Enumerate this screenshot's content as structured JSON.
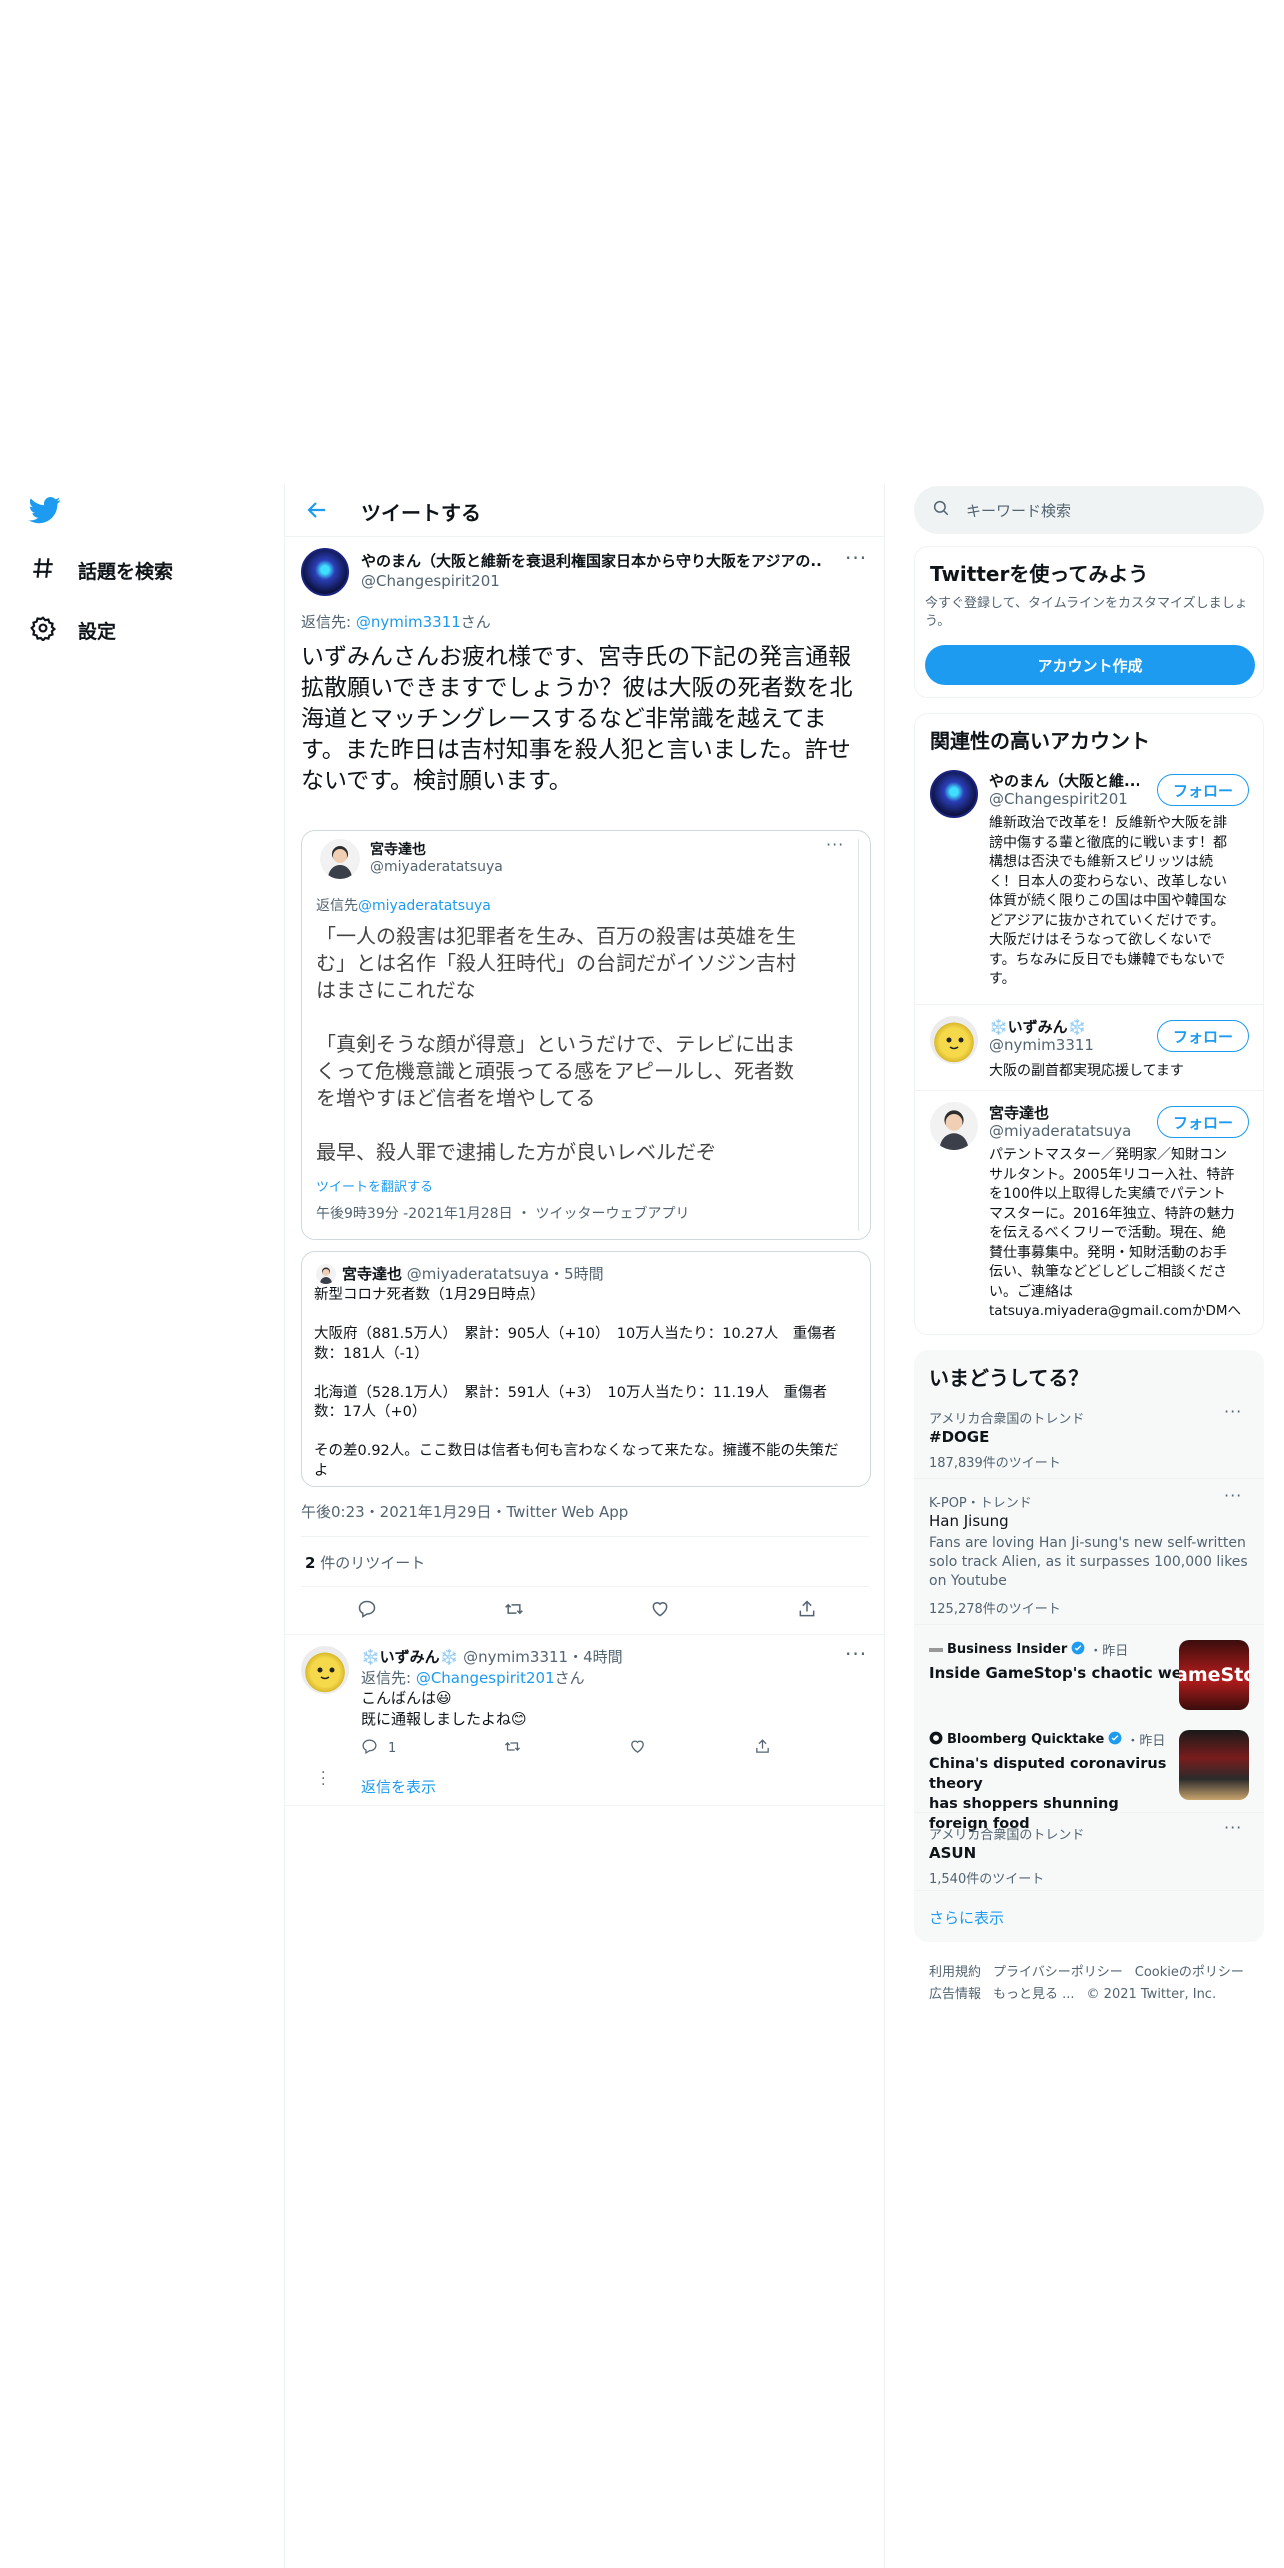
{
  "nav": {
    "explore_label": "話題を検索",
    "settings_label": "設定"
  },
  "header": {
    "title": "ツイートする"
  },
  "main_tweet": {
    "display_name": "やのまん（大阪と維新を衰退利権国家日本から守り大阪をアジアの...",
    "handle": "@Changespirit201",
    "reply_prefix": "返信先: ",
    "reply_to": "@nymim3311",
    "reply_suffix": "さん",
    "text_lines": [
      "いずみんさんお疲れ様です、宮寺氏の下記の発言通報",
      "拡散願いできますでしょうか？彼は大阪の死者数を北",
      "海道とマッチングレースするなど非常識を越えてま",
      "す。また昨日は吉村知事を殺人犯と言いました。許せ",
      "ないです。検討願います。"
    ],
    "timestamp": "午後0:23・2021年1月29日・Twitter Web App",
    "retweet_count": "2",
    "retweet_label": " 件のリツイート"
  },
  "embedded_tweet": {
    "display_name": "宮寺達也",
    "handle": "@miyaderatatsuya",
    "reply_prefix": "返信先",
    "reply_to": "@miyaderatatsuya",
    "paragraphs": [
      [
        "「一人の殺害は犯罪者を生み、百万の殺害は英雄を生",
        "む」とは名作「殺人狂時代」の台詞だがイソジン吉村",
        "はまさにこれだな"
      ],
      [
        "「真剣そうな顔が得意」というだけで、テレビに出ま",
        "くって危機意識と頑張ってる感をアピールし、死者数",
        "を増やすほど信者を増やしてる"
      ],
      [
        "最早、殺人罪で逮捕した方が良いレベルだぞ"
      ]
    ],
    "translate_label": "ツイートを翻訳する",
    "meta": "午後9時39分 -2021年1月28日 ・ ツイッターウェブアプリ"
  },
  "quoted_tweet": {
    "display_name": "宮寺達也",
    "handle": "@miyaderatatsuya",
    "time": "・5時間",
    "lines": [
      "新型コロナ死者数（1月29日時点）",
      "",
      "大阪府（881.5万人）　累計：905人（+10）　10万人当たり：10.27人　重傷者",
      "数：181人（-1）",
      "",
      "北海道（528.1万人）　累計：591人（+3）　10万人当たり：11.19人　重傷者",
      "数：17人（+0）",
      "",
      "その差0.92人。ここ数日は信者も何も言わなくなって来たな。擁護不能の失策だ",
      "よ"
    ]
  },
  "reply_tweet": {
    "display_name": "❄️いずみん❄️",
    "handle": "@nymim3311",
    "time": "・4時間",
    "reply_prefix": "返信先: ",
    "reply_to": "@Changespirit201",
    "reply_suffix": "さん",
    "line1": "こんばんは😃",
    "line2": "既に通報しましたよね😊",
    "reply_count": "1",
    "show_replies": "返信を表示"
  },
  "search": {
    "placeholder": "キーワード検索"
  },
  "signup": {
    "title": "Twitterを使ってみよう",
    "desc": "今すぐ登録して、タイムラインをカスタマイズしましょう。",
    "button": "アカウント作成"
  },
  "related": {
    "title": "関連性の高いアカウント",
    "follow_label": "フォロー",
    "accounts": [
      {
        "name": "やのまん（大阪と維...",
        "handle": "@Changespirit201",
        "bio_lines": [
          "維新政治で改革を！反維新や大阪を誹",
          "謗中傷する輩と徹底的に戦います！都",
          "構想は否決でも維新スピリッツは続",
          "く！日本人の変わらない、改革しない",
          "体質が続く限りこの国は中国や韓国な",
          "どアジアに抜かされていくだけです。",
          "大阪だけはそうなって欲しくないで",
          "す。ちなみに反日でも嫌韓でもないで",
          "す。"
        ]
      },
      {
        "name": "❄️いずみん❄️",
        "handle": "@nymim3311",
        "bio_lines": [
          "大阪の副首都実現応援してます"
        ]
      },
      {
        "name": "宮寺達也",
        "handle": "@miyaderatatsuya",
        "bio_lines": [
          "パテントマスター／発明家／知財コン",
          "サルタント。2005年リコー入社、特許",
          "を100件以上取得した実績でパテント",
          "マスターに。2016年独立、特許の魅力",
          "を伝えるべくフリーで活動。現在、絶",
          "賛仕事募集中。発明・知財活動のお手",
          "伝い、執筆などどしどしご相談くださ",
          "い。ご連絡は",
          "tatsuya.miyadera@gmail.comかDMへ"
        ]
      }
    ]
  },
  "trends": {
    "title": "いまどうしてる？",
    "items": [
      {
        "context": "アメリカ合衆国のトレンド",
        "name": "#DOGE",
        "count": "187,839件のツイート"
      },
      {
        "context": "K-POP・トレンド",
        "name": "Han Jisung",
        "desc_lines": [
          "Fans are loving Han Ji-sung's new self-written",
          "solo track Alien, as it surpasses 100,000 likes",
          "on Youtube"
        ],
        "count": "125,278件のツイート"
      },
      {
        "source": "Business Insider",
        "time": "・昨日",
        "headline": "Inside GameStop's chaotic week",
        "thumb_text": "ameStop"
      },
      {
        "source": "Bloomberg Quicktake",
        "time": "・昨日",
        "headline_lines": [
          "China's disputed coronavirus theory",
          "has shoppers shunning foreign food"
        ]
      },
      {
        "context": "アメリカ合衆国のトレンド",
        "name": "ASUN",
        "count": "1,540件のツイート"
      }
    ],
    "show_more": "さらに表示"
  },
  "footer": {
    "row1": [
      "利用規約",
      "プライバシーポリシー",
      "Cookieのポリシー"
    ],
    "row2": [
      "広告情報",
      "もっと見る ..."
    ],
    "copyright": "© 2021 Twitter, Inc."
  },
  "colors": {
    "accent": "#1d9bf0",
    "text": "#0f1419",
    "secondary": "#536471",
    "border": "#eff3f4"
  }
}
